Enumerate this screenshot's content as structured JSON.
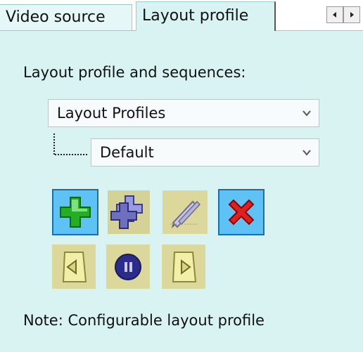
{
  "tabs": [
    {
      "label": "Video source",
      "active": false
    },
    {
      "label": "Layout profile",
      "active": true
    }
  ],
  "section_label": "Layout profile and sequences:",
  "profile_select": {
    "value": "Layout Profiles"
  },
  "sequence_select": {
    "value": "Default"
  },
  "toolbar": {
    "buttons": [
      {
        "name": "add",
        "icon": "add-icon",
        "state": "active"
      },
      {
        "name": "copy",
        "icon": "copy-add-icon",
        "state": "disabled"
      },
      {
        "name": "edit",
        "icon": "pencil-icon",
        "state": "disabled"
      },
      {
        "name": "delete",
        "icon": "delete-x-icon",
        "state": "active"
      },
      {
        "name": "previous",
        "icon": "previous-page-icon",
        "state": "disabled"
      },
      {
        "name": "pause",
        "icon": "pause-icon",
        "state": "disabled"
      },
      {
        "name": "next",
        "icon": "next-page-icon",
        "state": "disabled"
      }
    ]
  },
  "note": "Note: Configurable layout profile",
  "colors": {
    "panel_bg": "#d9f2f2",
    "active_button_bg": "#5fc2f5",
    "disabled_button_bg": "#dcd89b"
  }
}
